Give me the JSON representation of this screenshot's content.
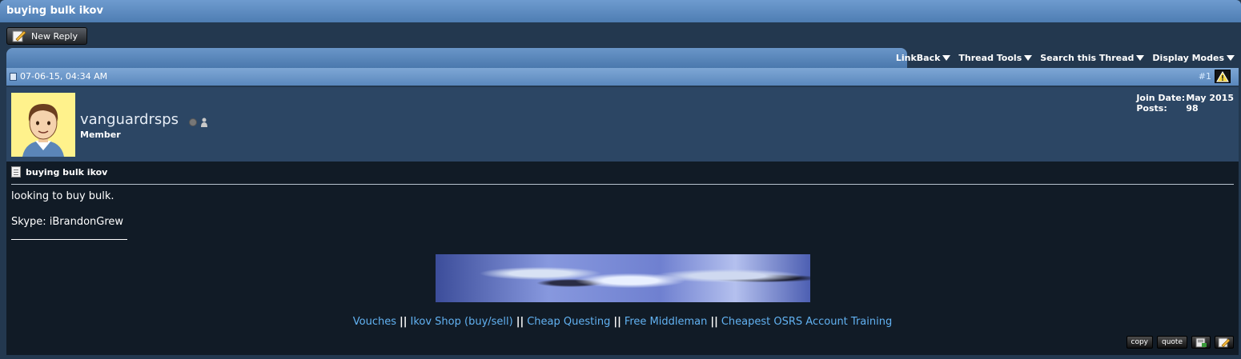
{
  "thread": {
    "title": "buying bulk ikov"
  },
  "new_reply_label": "New Reply",
  "toolbar": [
    "LinkBack",
    "Thread Tools",
    "Search this Thread",
    "Display Modes"
  ],
  "post": {
    "date": "07-06-15, 04:34 AM",
    "number": "#1",
    "title": "buying bulk ikov",
    "body_line1": "looking to buy bulk.",
    "body_line2": "Skype: iBrandonGrew"
  },
  "user": {
    "name": "vanguardrsps",
    "title": "Member",
    "join_label": "Join Date:",
    "join_value": "May 2015",
    "posts_label": "Posts:",
    "posts_value": "98"
  },
  "signature_links": [
    "Vouches",
    "Ikov Shop (buy/sell)",
    "Cheap Questing",
    "Free Middleman",
    "Cheapest OSRS Account Training"
  ],
  "signature_sep": "||",
  "actions": {
    "copy": "copy",
    "quote": "quote"
  },
  "colors": {
    "accent": "#5a88bd",
    "link": "#62b2f2",
    "body_bg": "#111b26"
  },
  "icons": [
    "new-reply-pen-icon",
    "dropdown-arrow-icon",
    "post-icon",
    "warning-icon",
    "offline-status-icon",
    "profile-icon",
    "page-icon",
    "multi-quote-icon",
    "edit-icon"
  ]
}
